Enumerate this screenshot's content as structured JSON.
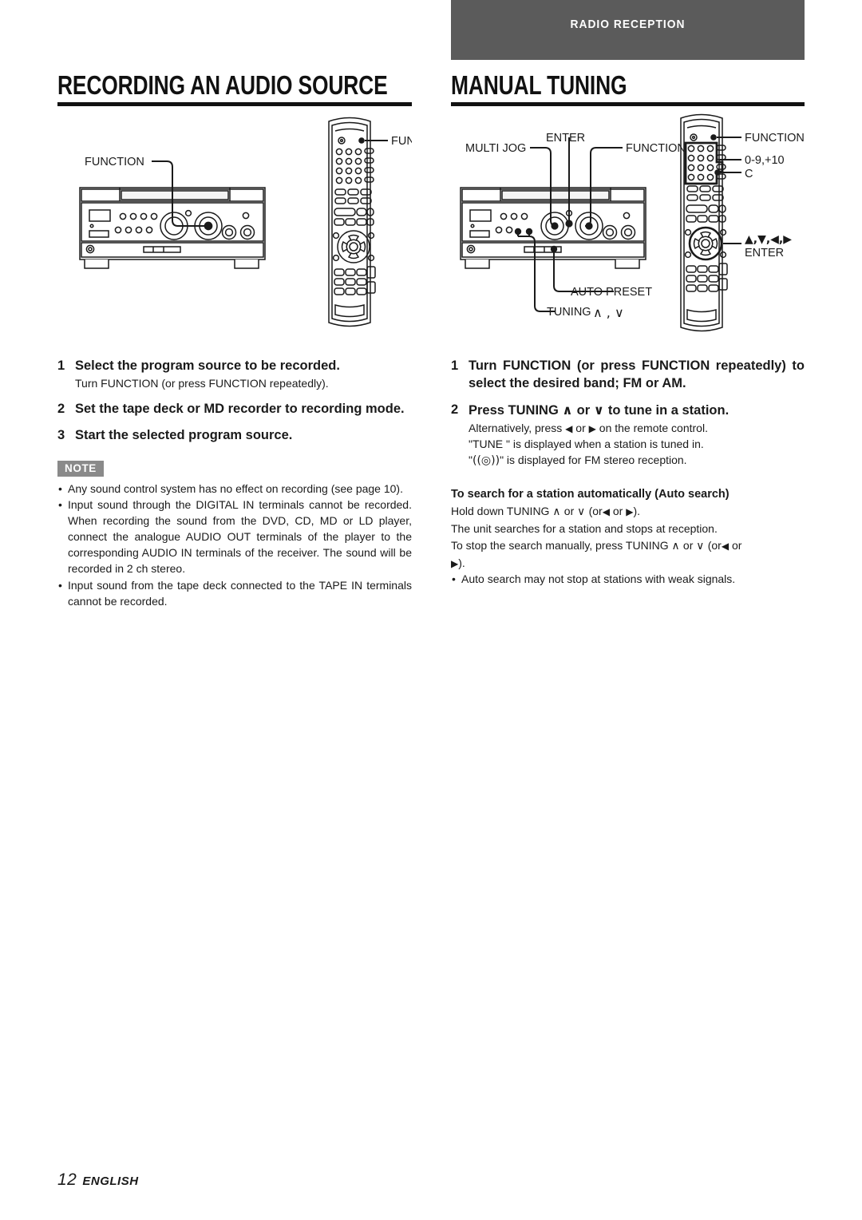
{
  "banner": {
    "label": "RADIO RECEPTION"
  },
  "headings": {
    "left": "RECORDING AN AUDIO SOURCE",
    "right": "MANUAL TUNING"
  },
  "diagram_left": {
    "callouts": [
      {
        "name": "receiver-function",
        "text": "FUNCTION"
      },
      {
        "name": "remote-function",
        "text": "FUNCTION"
      }
    ]
  },
  "diagram_right": {
    "callouts": [
      {
        "name": "multi-jog",
        "text": "MULTI JOG"
      },
      {
        "name": "enter",
        "text": "ENTER"
      },
      {
        "name": "receiver-function",
        "text": "FUNCTION"
      },
      {
        "name": "auto-preset",
        "text": "AUTO PRESET"
      },
      {
        "name": "tuning",
        "text": "TUNING"
      },
      {
        "name": "tuning-glyphs",
        "text": "∧ , ∨"
      },
      {
        "name": "remote-function",
        "text": "FUNCTION"
      },
      {
        "name": "numeric-keys",
        "text": "0-9,+10"
      },
      {
        "name": "clear-key",
        "text": "C"
      },
      {
        "name": "cursor-keys",
        "text": "▲,▼,◀,▶"
      },
      {
        "name": "remote-enter",
        "text": "ENTER"
      }
    ]
  },
  "left_column": {
    "steps": [
      {
        "num": "1",
        "title": "Select the program source to be recorded.",
        "sub": "Turn FUNCTION (or press FUNCTION repeatedly)."
      },
      {
        "num": "2",
        "title": "Set the tape deck or MD recorder to recording mode.",
        "sub": ""
      },
      {
        "num": "3",
        "title": "Start the selected program source.",
        "sub": ""
      }
    ],
    "note_badge": "NOTE",
    "notes": [
      "Any sound control system has no effect on recording (see page 10).",
      "Input sound through the DIGITAL IN terminals cannot be recorded. When recording the sound from the DVD, CD, MD or LD player, connect the analogue AUDIO OUT terminals of the player to the corresponding AUDIO IN terminals of the receiver. The sound will be recorded in 2 ch stereo.",
      "Input sound from the tape deck connected to the TAPE IN terminals cannot be recorded."
    ]
  },
  "right_column": {
    "step1": {
      "num": "1",
      "title": "Turn FUNCTION (or press FUNCTION repeatedly) to select the desired band; FM or AM."
    },
    "step2": {
      "num": "2",
      "title_a": "Press TUNING",
      "glyph_up": "∧",
      "title_b": "or",
      "glyph_down": "∨",
      "title_c": "to tune in a station.",
      "sub_a": "Alternatively, press",
      "glyph_left": "◀",
      "sub_b": "or",
      "glyph_right": "▶",
      "sub_c": "on the remote control.",
      "sub_line2": "\"TUNE \" is displayed when a station is tuned in.",
      "sub_line3_a": "\"",
      "sub_line3_glyph": "((◎))",
      "sub_line3_b": "\" is displayed for FM stereo reception."
    },
    "auto_search": {
      "heading": "To search for a station automatically (Auto search)",
      "line1_a": "Hold down TUNING",
      "line1_up": "∧",
      "line1_b": "or",
      "line1_down": "∨",
      "line1_c": "(or",
      "line1_left": "◀",
      "line1_d": "or",
      "line1_right": "▶",
      "line1_e": ").",
      "line2": "The unit searches for a station and stops at reception.",
      "line3_a": "To stop the search manually, press TUNING",
      "line3_up": "∧",
      "line3_b": "or",
      "line3_down": "∨",
      "line3_c": "(or",
      "line3_left": "◀",
      "line3_d": "or",
      "line4_right": "▶",
      "line4_e": ").",
      "bullet": "Auto search may not stop at stations with weak signals."
    }
  },
  "footer": {
    "page": "12",
    "language": "ENGLISH"
  }
}
